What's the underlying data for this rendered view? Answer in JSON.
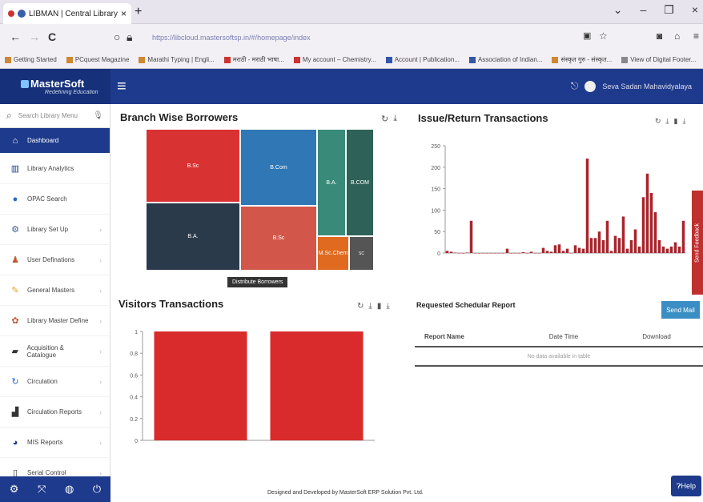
{
  "browser": {
    "tab_title": "LIBMAN | Central Library",
    "tab_close": "×",
    "new_tab": "+",
    "back": "←",
    "forward": "→",
    "reload": "C",
    "minimize": "–",
    "restore": "❐",
    "close": "×",
    "url": "https://libcloud.mastersoftsp.in/#/homepage/index",
    "bookmarks": [
      "Getting Started",
      "PCquest Magazine",
      "Marathi Typing | Engli...",
      "मराठी - मराठी भाषा...",
      "My account – Chemistry...",
      "Account | Publication...",
      "Association of Indian...",
      "संस्कृत गुरु - संस्कृत...",
      "View of Digital Footer..."
    ]
  },
  "header": {
    "logo_title": "MasterSoft",
    "logo_subtitle": "Redefining Education",
    "user_name": "Seva Sadan Mahavidyalaya"
  },
  "sidebar": {
    "search_placeholder": "Search Library Menu",
    "items": [
      {
        "label": "Dashboard",
        "icon": "home-icon"
      },
      {
        "label": "Library Analytics",
        "icon": "bar-chart-icon"
      },
      {
        "label": "OPAC Search",
        "icon": "search-circle-icon"
      },
      {
        "label": "Library Set Up",
        "icon": "gear-icon"
      },
      {
        "label": "User Definations",
        "icon": "users-icon"
      },
      {
        "label": "General Masters",
        "icon": "pen-icon"
      },
      {
        "label": "Library Master Define",
        "icon": "cog-icon"
      },
      {
        "label": "Acquisition & Catalogue",
        "icon": "book-icon"
      },
      {
        "label": "Circulation",
        "icon": "refresh-icon"
      },
      {
        "label": "Circulation Reports",
        "icon": "report-icon"
      },
      {
        "label": "MIS Reports",
        "icon": "pie-icon"
      },
      {
        "label": "Serial Control",
        "icon": "file-icon"
      }
    ]
  },
  "panels": {
    "branch_title": "Branch Wise Borrowers",
    "issue_title": "Issue/Return Transactions",
    "visitors_title": "Visitors Transactions",
    "report_title": "Requested Schedular Report",
    "send_mail": "Send Mail",
    "tooltip": "Distribute Borrowers",
    "report_columns": [
      "Report Name",
      "Date Time",
      "Download"
    ],
    "report_empty": "No data available in table",
    "feedback": "Send Feedback"
  },
  "footer": {
    "text": "Designed and Developed by MasterSoft ERP Solution Pvt. Ltd.",
    "help": "Help"
  },
  "chart_data": [
    {
      "type": "treemap",
      "title": "Branch Wise Borrowers",
      "labels": [
        "B.Sc",
        "B.Com",
        "B.A.",
        "B.COM",
        "B.A.",
        "B.Sc",
        "M.Sc.Chem",
        "SC"
      ],
      "colors": [
        "#d93232",
        "#2f77b5",
        "#3a8a7a",
        "#2e6157",
        "#2b3a4a",
        "#d2574a",
        "#e06a20",
        "#555555"
      ]
    },
    {
      "type": "bar",
      "title": "Issue/Return Transactions",
      "ylim": [
        0,
        250
      ],
      "yticks": [
        0,
        50,
        100,
        150,
        200,
        250
      ],
      "values": [
        5,
        3,
        1,
        0,
        0,
        1,
        75,
        0,
        0,
        0,
        0,
        0,
        0,
        0,
        0,
        10,
        0,
        0,
        0,
        2,
        0,
        3,
        0,
        0,
        12,
        5,
        3,
        18,
        20,
        5,
        10,
        0,
        18,
        12,
        10,
        220,
        35,
        35,
        50,
        30,
        75,
        5,
        40,
        35,
        85,
        10,
        30,
        55,
        15,
        130,
        185,
        140,
        95,
        30,
        15,
        10,
        15,
        25,
        15,
        75
      ],
      "color": "#a8252d"
    },
    {
      "type": "bar",
      "title": "Visitors Transactions",
      "ylim": [
        0,
        1
      ],
      "yticks": [
        "0",
        "0.2",
        "0.4",
        "0.6",
        "0.8",
        "1"
      ],
      "values": [
        1,
        1
      ],
      "color": "#d92b2b"
    }
  ]
}
